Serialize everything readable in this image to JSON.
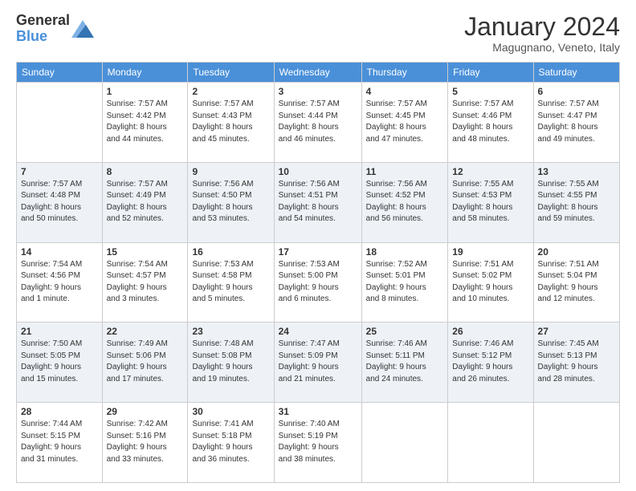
{
  "header": {
    "logo_general": "General",
    "logo_blue": "Blue",
    "title": "January 2024",
    "location": "Magugnano, Veneto, Italy"
  },
  "days_of_week": [
    "Sunday",
    "Monday",
    "Tuesday",
    "Wednesday",
    "Thursday",
    "Friday",
    "Saturday"
  ],
  "weeks": [
    [
      {
        "day": "",
        "info": ""
      },
      {
        "day": "1",
        "info": "Sunrise: 7:57 AM\nSunset: 4:42 PM\nDaylight: 8 hours\nand 44 minutes."
      },
      {
        "day": "2",
        "info": "Sunrise: 7:57 AM\nSunset: 4:43 PM\nDaylight: 8 hours\nand 45 minutes."
      },
      {
        "day": "3",
        "info": "Sunrise: 7:57 AM\nSunset: 4:44 PM\nDaylight: 8 hours\nand 46 minutes."
      },
      {
        "day": "4",
        "info": "Sunrise: 7:57 AM\nSunset: 4:45 PM\nDaylight: 8 hours\nand 47 minutes."
      },
      {
        "day": "5",
        "info": "Sunrise: 7:57 AM\nSunset: 4:46 PM\nDaylight: 8 hours\nand 48 minutes."
      },
      {
        "day": "6",
        "info": "Sunrise: 7:57 AM\nSunset: 4:47 PM\nDaylight: 8 hours\nand 49 minutes."
      }
    ],
    [
      {
        "day": "7",
        "info": "Sunrise: 7:57 AM\nSunset: 4:48 PM\nDaylight: 8 hours\nand 50 minutes."
      },
      {
        "day": "8",
        "info": "Sunrise: 7:57 AM\nSunset: 4:49 PM\nDaylight: 8 hours\nand 52 minutes."
      },
      {
        "day": "9",
        "info": "Sunrise: 7:56 AM\nSunset: 4:50 PM\nDaylight: 8 hours\nand 53 minutes."
      },
      {
        "day": "10",
        "info": "Sunrise: 7:56 AM\nSunset: 4:51 PM\nDaylight: 8 hours\nand 54 minutes."
      },
      {
        "day": "11",
        "info": "Sunrise: 7:56 AM\nSunset: 4:52 PM\nDaylight: 8 hours\nand 56 minutes."
      },
      {
        "day": "12",
        "info": "Sunrise: 7:55 AM\nSunset: 4:53 PM\nDaylight: 8 hours\nand 58 minutes."
      },
      {
        "day": "13",
        "info": "Sunrise: 7:55 AM\nSunset: 4:55 PM\nDaylight: 8 hours\nand 59 minutes."
      }
    ],
    [
      {
        "day": "14",
        "info": "Sunrise: 7:54 AM\nSunset: 4:56 PM\nDaylight: 9 hours\nand 1 minute."
      },
      {
        "day": "15",
        "info": "Sunrise: 7:54 AM\nSunset: 4:57 PM\nDaylight: 9 hours\nand 3 minutes."
      },
      {
        "day": "16",
        "info": "Sunrise: 7:53 AM\nSunset: 4:58 PM\nDaylight: 9 hours\nand 5 minutes."
      },
      {
        "day": "17",
        "info": "Sunrise: 7:53 AM\nSunset: 5:00 PM\nDaylight: 9 hours\nand 6 minutes."
      },
      {
        "day": "18",
        "info": "Sunrise: 7:52 AM\nSunset: 5:01 PM\nDaylight: 9 hours\nand 8 minutes."
      },
      {
        "day": "19",
        "info": "Sunrise: 7:51 AM\nSunset: 5:02 PM\nDaylight: 9 hours\nand 10 minutes."
      },
      {
        "day": "20",
        "info": "Sunrise: 7:51 AM\nSunset: 5:04 PM\nDaylight: 9 hours\nand 12 minutes."
      }
    ],
    [
      {
        "day": "21",
        "info": "Sunrise: 7:50 AM\nSunset: 5:05 PM\nDaylight: 9 hours\nand 15 minutes."
      },
      {
        "day": "22",
        "info": "Sunrise: 7:49 AM\nSunset: 5:06 PM\nDaylight: 9 hours\nand 17 minutes."
      },
      {
        "day": "23",
        "info": "Sunrise: 7:48 AM\nSunset: 5:08 PM\nDaylight: 9 hours\nand 19 minutes."
      },
      {
        "day": "24",
        "info": "Sunrise: 7:47 AM\nSunset: 5:09 PM\nDaylight: 9 hours\nand 21 minutes."
      },
      {
        "day": "25",
        "info": "Sunrise: 7:46 AM\nSunset: 5:11 PM\nDaylight: 9 hours\nand 24 minutes."
      },
      {
        "day": "26",
        "info": "Sunrise: 7:46 AM\nSunset: 5:12 PM\nDaylight: 9 hours\nand 26 minutes."
      },
      {
        "day": "27",
        "info": "Sunrise: 7:45 AM\nSunset: 5:13 PM\nDaylight: 9 hours\nand 28 minutes."
      }
    ],
    [
      {
        "day": "28",
        "info": "Sunrise: 7:44 AM\nSunset: 5:15 PM\nDaylight: 9 hours\nand 31 minutes."
      },
      {
        "day": "29",
        "info": "Sunrise: 7:42 AM\nSunset: 5:16 PM\nDaylight: 9 hours\nand 33 minutes."
      },
      {
        "day": "30",
        "info": "Sunrise: 7:41 AM\nSunset: 5:18 PM\nDaylight: 9 hours\nand 36 minutes."
      },
      {
        "day": "31",
        "info": "Sunrise: 7:40 AM\nSunset: 5:19 PM\nDaylight: 9 hours\nand 38 minutes."
      },
      {
        "day": "",
        "info": ""
      },
      {
        "day": "",
        "info": ""
      },
      {
        "day": "",
        "info": ""
      }
    ]
  ]
}
